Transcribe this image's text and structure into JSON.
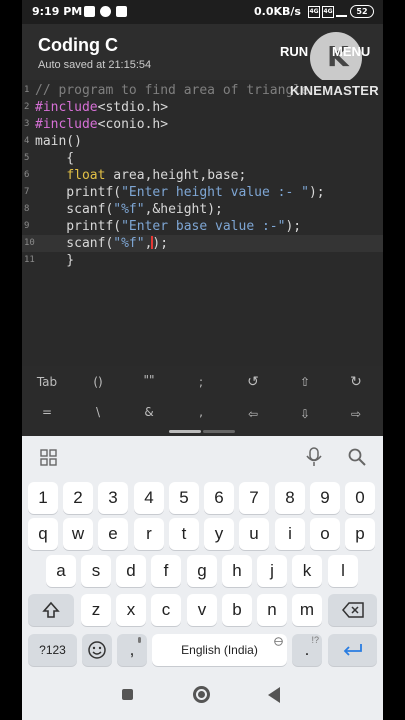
{
  "status": {
    "time": "9:19 PM",
    "net_speed": "0.0KB/s",
    "battery": "52",
    "sig1": "4G",
    "sig2": "4G"
  },
  "app": {
    "title": "Coding C",
    "subtitle": "Auto saved at 21:15:54",
    "run_label": "RUN",
    "menu_label": "MENU"
  },
  "watermark": "KINEMASTER",
  "editor": {
    "line_numbers": [
      "1",
      "2",
      "3",
      "4",
      "5",
      "6",
      "7",
      "8",
      "9",
      "10",
      "11"
    ],
    "lines": {
      "l1": "// program to find area of triangle",
      "l2_pre": "#include",
      "l2_inc": "<stdio.h>",
      "l3_pre": "#include",
      "l3_inc": "<conio.h>",
      "l4": "main()",
      "l5": "    {",
      "l6_kw": "float",
      "l6_rest": " area,height,base;",
      "l7_a": "    printf(",
      "l7_str": "\"Enter height value :- \"",
      "l7_b": ");",
      "l8_a": "    scanf(",
      "l8_str": "\"%f\"",
      "l8_b": ",&height);",
      "l9_a": "    printf(",
      "l9_str": "\"Enter base value :-\"",
      "l9_b": ");",
      "l10_a": "    scanf(",
      "l10_str": "\"%f\"",
      "l10_b": ",",
      "l10_c": ");",
      "l11": "    }"
    }
  },
  "symbols": {
    "row1": [
      "Tab",
      "()",
      "\"\"",
      ";",
      "↺",
      "⇧",
      "↻"
    ],
    "row2": [
      "=",
      "\\",
      "&",
      ",",
      "⇦",
      "⇩",
      "⇨"
    ]
  },
  "keyboard": {
    "numbers": [
      "1",
      "2",
      "3",
      "4",
      "5",
      "6",
      "7",
      "8",
      "9",
      "0"
    ],
    "row1": [
      "q",
      "w",
      "e",
      "r",
      "t",
      "y",
      "u",
      "i",
      "o",
      "p"
    ],
    "row2": [
      "a",
      "s",
      "d",
      "f",
      "g",
      "h",
      "j",
      "k",
      "l"
    ],
    "row3": [
      "z",
      "x",
      "c",
      "v",
      "b",
      "n",
      "m"
    ],
    "sym_key": "?123",
    "comma": ",",
    "space": "English (India)",
    "period": "."
  }
}
